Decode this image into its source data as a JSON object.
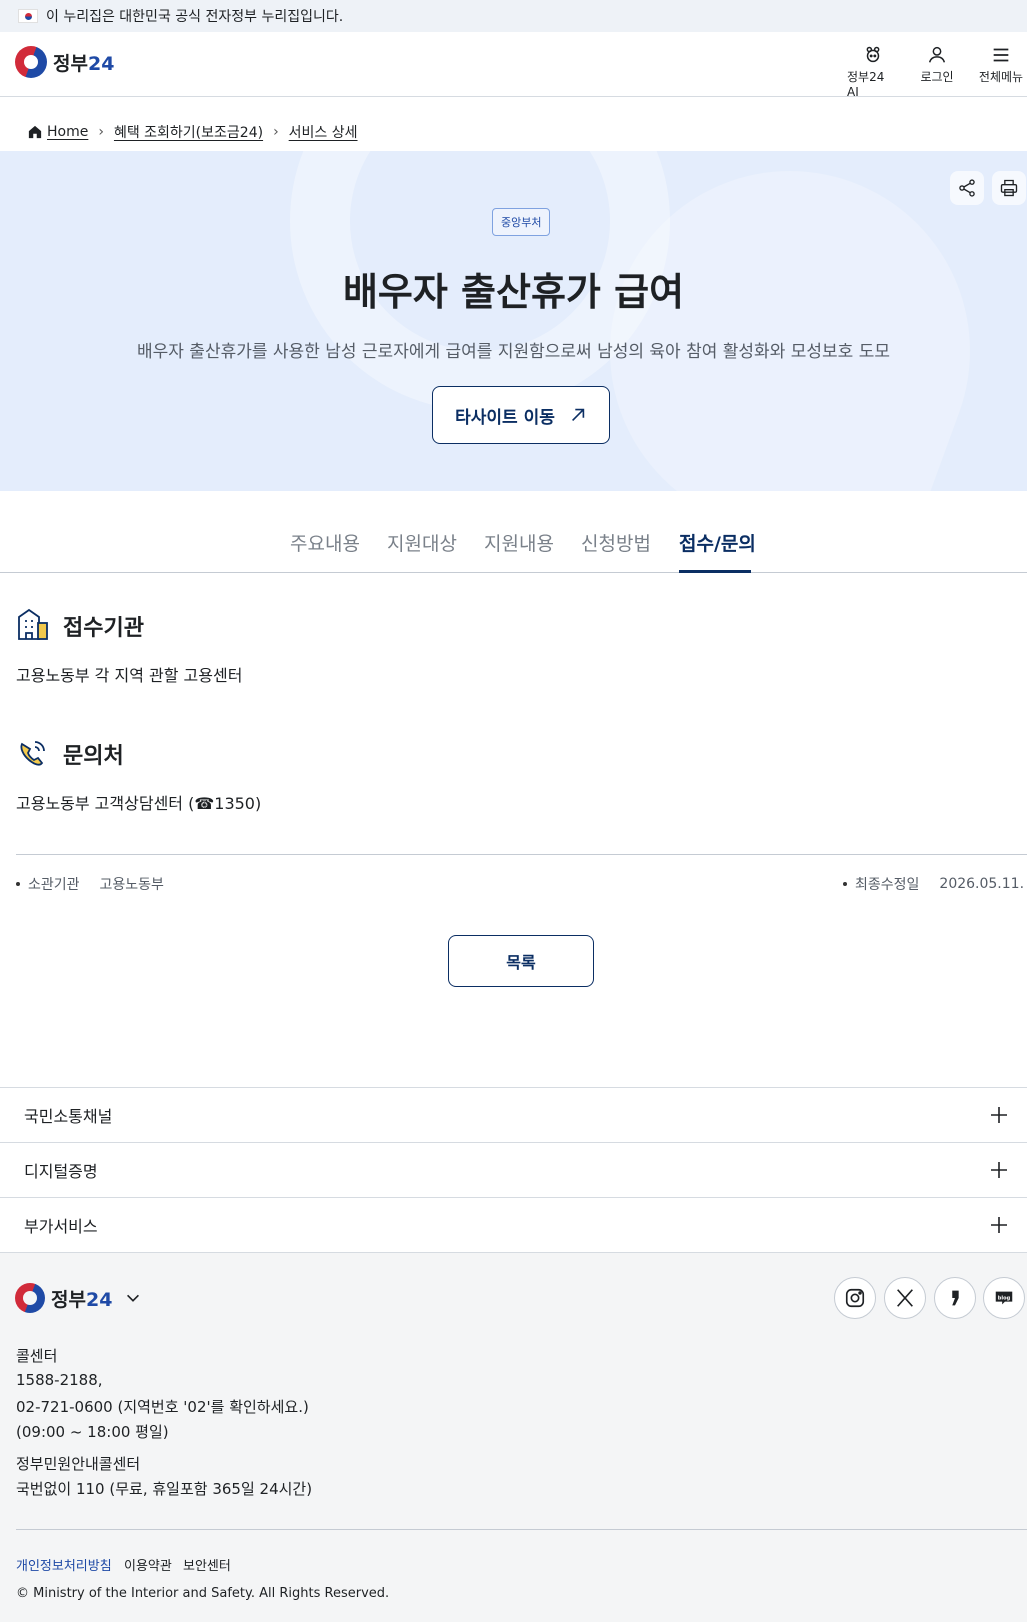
{
  "banner": {
    "text": "이 누리집은 대한민국 공식 전자정부 누리집입니다."
  },
  "header": {
    "logo_text": "정부",
    "logo_num": "24",
    "buttons": [
      {
        "label": "정부24 AI",
        "icon": "ai-assistant-icon"
      },
      {
        "label": "로그인",
        "icon": "user-icon"
      },
      {
        "label": "전체메뉴",
        "icon": "menu-icon"
      }
    ]
  },
  "breadcrumb": {
    "items": [
      "Home",
      "혜택 조회하기(보조금24)",
      "서비스 상세"
    ]
  },
  "hero": {
    "badge": "중앙부처",
    "title": "배우자 출산휴가 급여",
    "description": "배우자 출산휴가를 사용한 남성 근로자에게 급여를 지원함으로써 남성의 육아 참여 활성화와 모성보호 도모",
    "external_button": "타사이트 이동"
  },
  "tabs": {
    "items": [
      "주요내용",
      "지원대상",
      "지원내용",
      "신청방법",
      "접수/문의"
    ],
    "active": "접수/문의"
  },
  "sections": {
    "reception": {
      "title": "접수기관",
      "text": "고용노동부 각 지역 관할 고용센터"
    },
    "inquiry": {
      "title": "문의처",
      "text": "고용노동부 고객상담센터 (☎1350)"
    }
  },
  "meta": {
    "agency_label": "소관기관",
    "agency_value": "고용노동부",
    "updated_label": "최종수정일",
    "updated_value": "2026.05.11."
  },
  "list_button": "목록",
  "accordions": [
    "국민소통채널",
    "디지털증명",
    "부가서비스"
  ],
  "footer": {
    "callcenter_title": "콜센터",
    "callcenter_numbers": "1588-2188,",
    "callcenter_alt": "02-721-0600 (지역번호 '02'를 확인하세요.)",
    "callcenter_hours": "(09:00 ~ 18:00 평일)",
    "civil_title": "정부민원안내콜센터",
    "civil_text": "국번없이 110 (무료, 휴일포함 365일 24시간)",
    "links": [
      "개인정보처리방침",
      "이용약관",
      "보안센터"
    ],
    "copyright": "© Ministry of the Interior and Safety. All Rights Reserved.",
    "sns": [
      "instagram-icon",
      "x-icon",
      "story-icon",
      "blog-icon"
    ]
  },
  "colors": {
    "primary": "#0b2e63",
    "brand_blue": "#1f4aa6",
    "brand_red": "#d12b3a",
    "hero_bg": "#e4edfc",
    "footer_bg": "#f4f5f6"
  }
}
